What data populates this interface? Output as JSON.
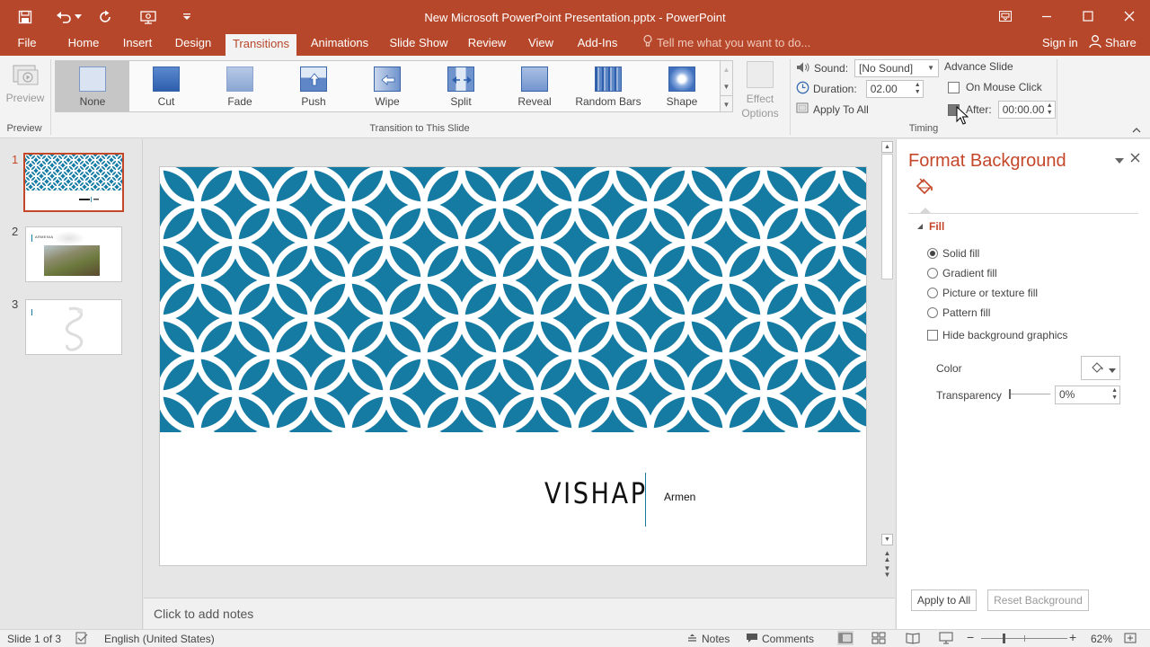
{
  "app": {
    "title": "New Microsoft PowerPoint Presentation.pptx - PowerPoint",
    "accent": "#b7472a"
  },
  "tabs": {
    "file": "File",
    "home": "Home",
    "insert": "Insert",
    "design": "Design",
    "transitions": "Transitions",
    "animations": "Animations",
    "slideshow": "Slide Show",
    "review": "Review",
    "view": "View",
    "addins": "Add-Ins",
    "tellme": "Tell me what you want to do...",
    "signin": "Sign in",
    "share": "Share"
  },
  "ribbon": {
    "preview_label": "Preview",
    "preview_group": "Preview",
    "transition_group": "Transition to This Slide",
    "transitions": [
      "None",
      "Cut",
      "Fade",
      "Push",
      "Wipe",
      "Split",
      "Reveal",
      "Random Bars",
      "Shape"
    ],
    "effect_options": "Effect Options",
    "timing_group": "Timing",
    "sound_label": "Sound:",
    "sound_value": "[No Sound]",
    "duration_label": "Duration:",
    "duration_value": "02.00",
    "apply_all": "Apply To All",
    "advance_slide": "Advance Slide",
    "on_mouse_click": "On Mouse Click",
    "after_label": "After:",
    "after_value": "00:00.00"
  },
  "slides": {
    "numbers": [
      "1",
      "2",
      "3"
    ],
    "thumb2_heading": "ARMENIA"
  },
  "slide": {
    "title": "VISHAP",
    "subtitle": "Armen",
    "pattern_color": "#167ba3"
  },
  "notes": {
    "placeholder": "Click to add notes"
  },
  "format_pane": {
    "title": "Format Background",
    "section": "Fill",
    "options": [
      "Solid fill",
      "Gradient fill",
      "Picture or texture fill",
      "Pattern fill"
    ],
    "selected_option": "Solid fill",
    "hide_graphics": "Hide background graphics",
    "color_label": "Color",
    "transparency_label": "Transparency",
    "transparency_value": "0%",
    "apply_all": "Apply to All",
    "reset": "Reset Background"
  },
  "statusbar": {
    "slide_info": "Slide 1 of 3",
    "language": "English (United States)",
    "notes": "Notes",
    "comments": "Comments",
    "zoom": "62%"
  }
}
